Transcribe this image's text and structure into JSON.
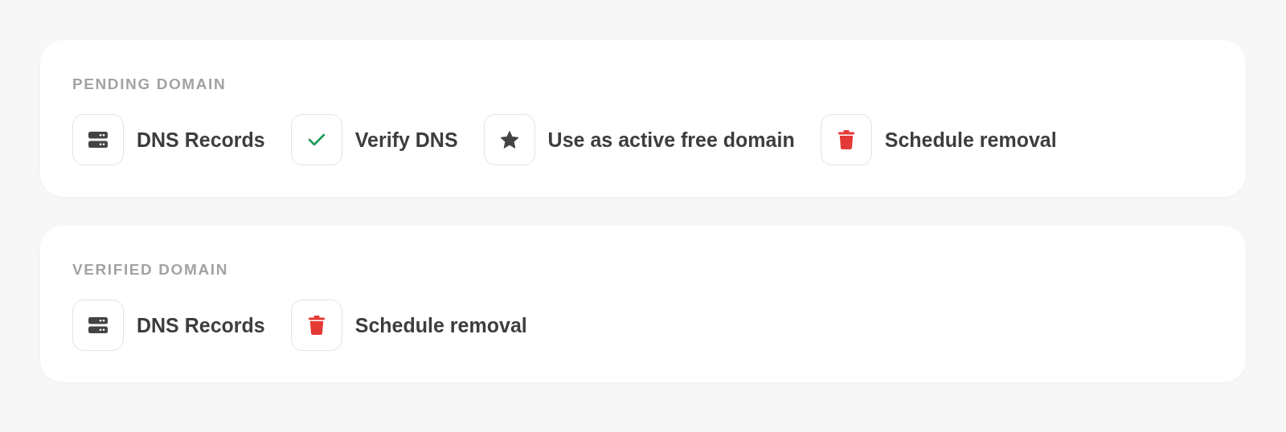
{
  "sections": [
    {
      "title": "PENDING DOMAIN",
      "actions": [
        {
          "kind": "server",
          "label": "DNS Records"
        },
        {
          "kind": "check",
          "label": "Verify DNS"
        },
        {
          "kind": "star",
          "label": "Use as active free domain"
        },
        {
          "kind": "trash",
          "label": "Schedule removal"
        }
      ]
    },
    {
      "title": "VERIFIED DOMAIN",
      "actions": [
        {
          "kind": "server",
          "label": "DNS Records"
        },
        {
          "kind": "trash",
          "label": "Schedule removal"
        }
      ]
    }
  ]
}
